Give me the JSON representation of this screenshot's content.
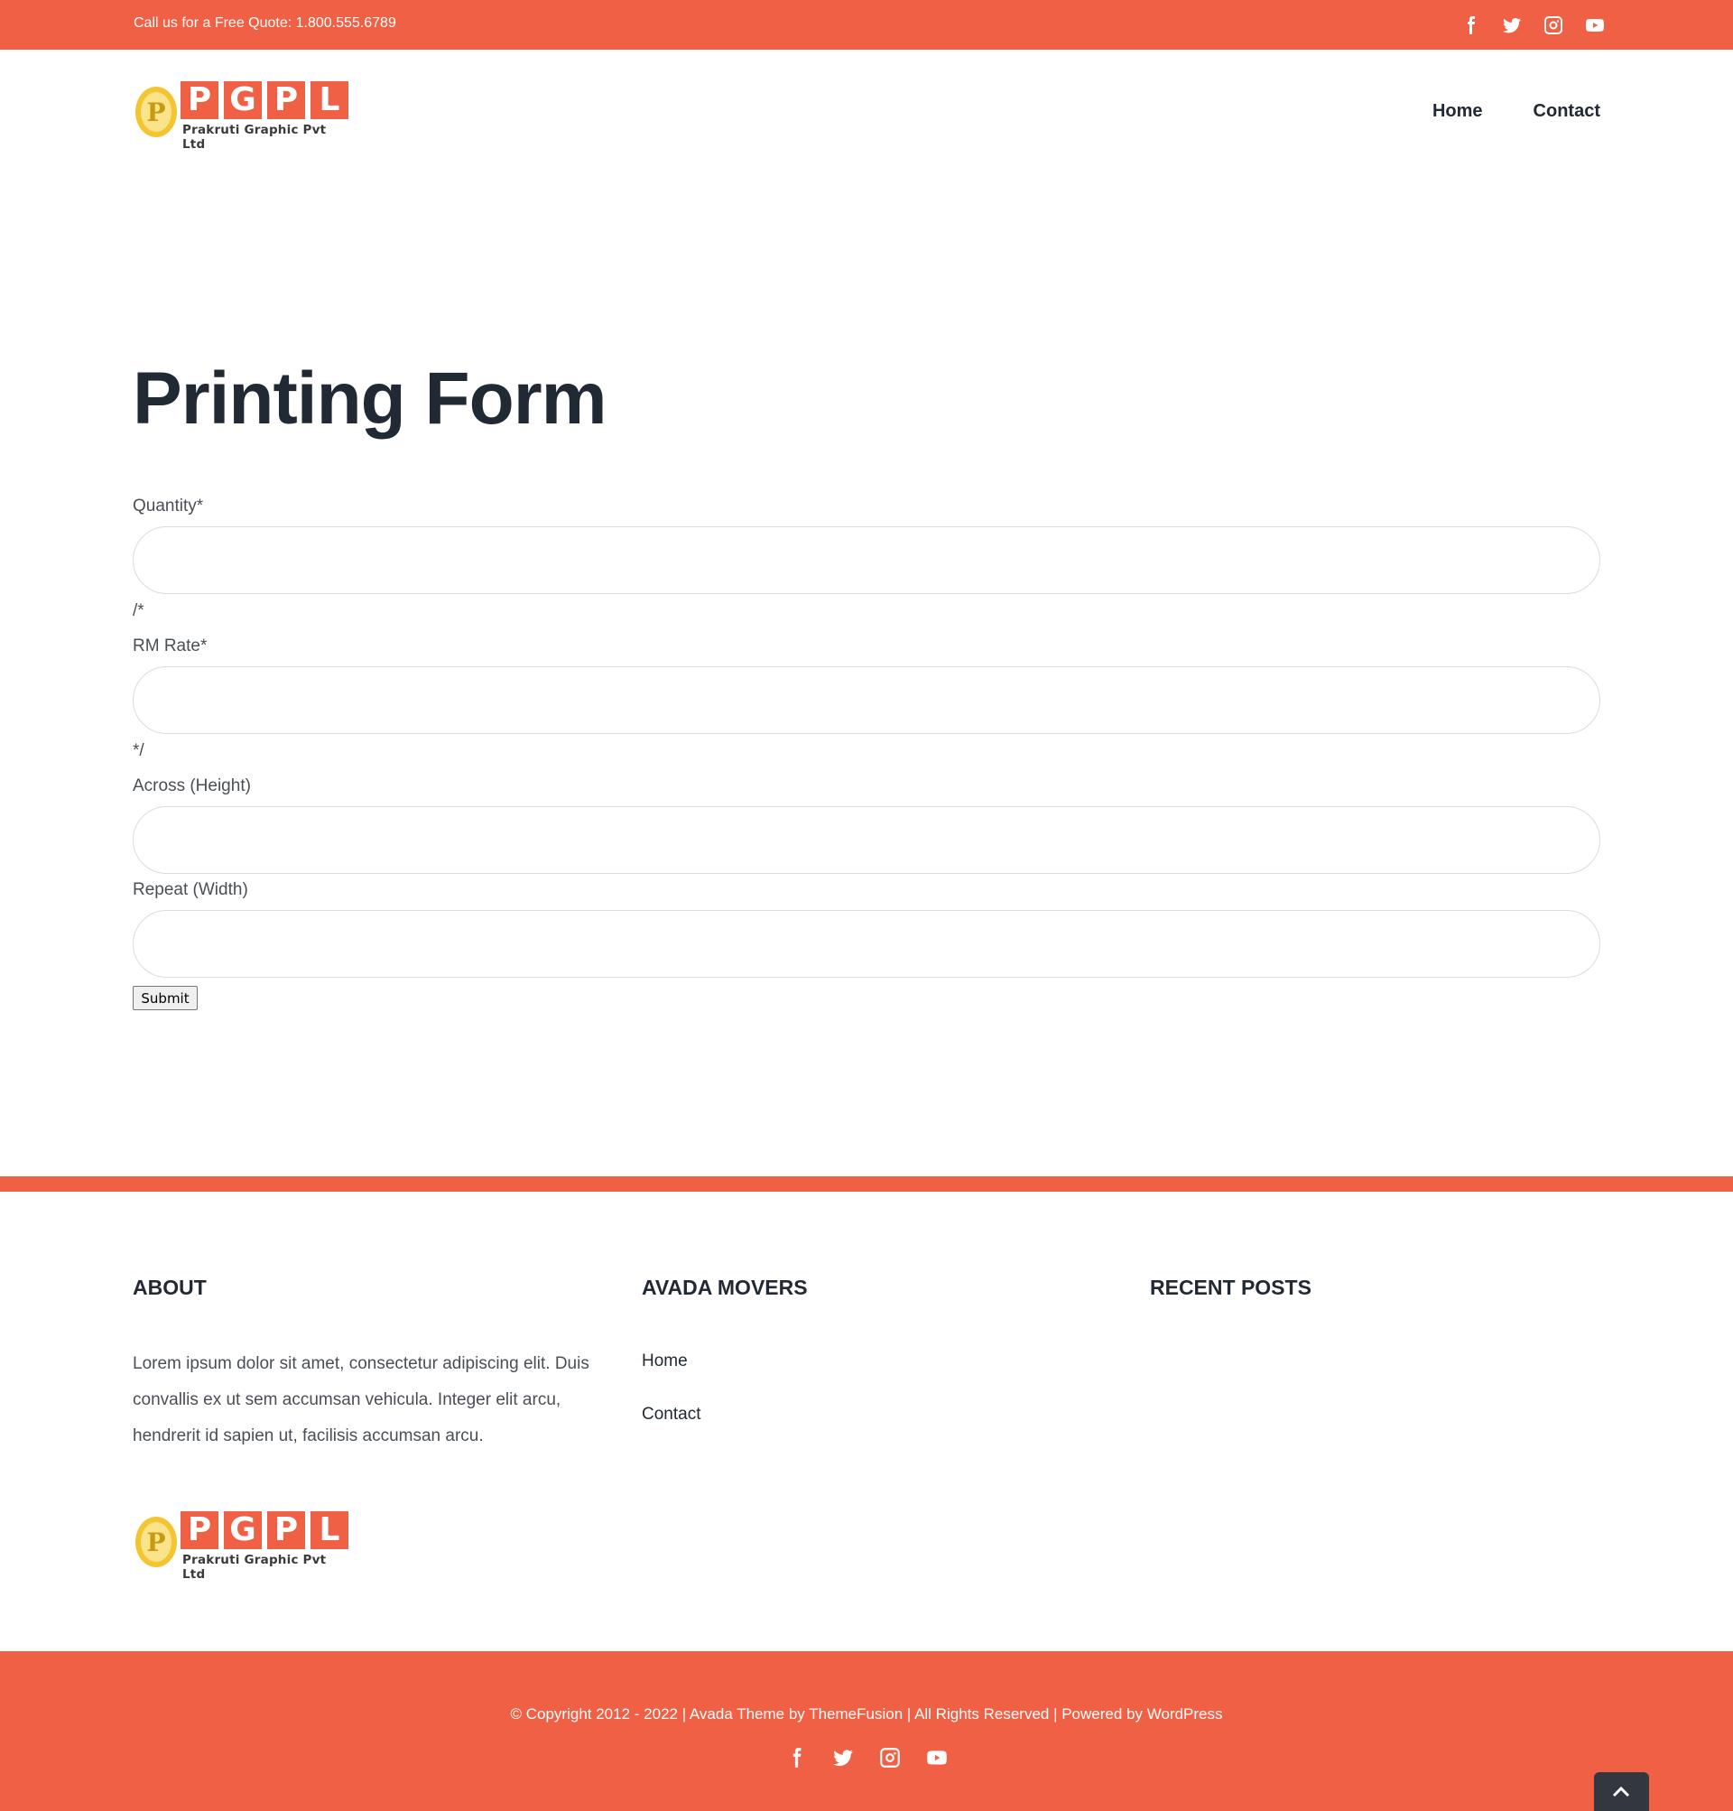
{
  "colors": {
    "brand": "#f06045",
    "text": "#212934",
    "muted": "#4a4f55"
  },
  "topbar": {
    "quote": "Call us for a Free Quote: 1.800.555.6789",
    "social_icons": [
      "facebook-icon",
      "twitter-icon",
      "instagram-icon",
      "youtube-icon"
    ]
  },
  "logo": {
    "letters": [
      "P",
      "G",
      "P",
      "L"
    ],
    "tagline": "Prakruti Graphic Pvt Ltd"
  },
  "nav": {
    "items": [
      {
        "label": "Home"
      },
      {
        "label": "Contact"
      }
    ]
  },
  "page": {
    "title": "Printing Form"
  },
  "form": {
    "quantity_label": "Quantity*",
    "comment_open": "/*",
    "rm_rate_label": "RM Rate*",
    "comment_close": "*/",
    "across_label": "Across (Height)",
    "repeat_label": "Repeat (Width)",
    "submit_label": "Submit"
  },
  "footer": {
    "about_title": "ABOUT",
    "about_text": "Lorem ipsum dolor sit amet, consectetur adipiscing elit. Duis convallis ex ut sem accumsan vehicula. Integer elit arcu, hendrerit id sapien ut, facilisis accumsan arcu.",
    "movers_title": "AVADA MOVERS",
    "links": [
      {
        "label": "Home"
      },
      {
        "label": "Contact"
      }
    ],
    "recent_title": "RECENT POSTS"
  },
  "copyright": {
    "text": "© Copyright 2012 - 2022 | Avada Theme by ThemeFusion | All Rights Reserved | Powered by WordPress"
  }
}
